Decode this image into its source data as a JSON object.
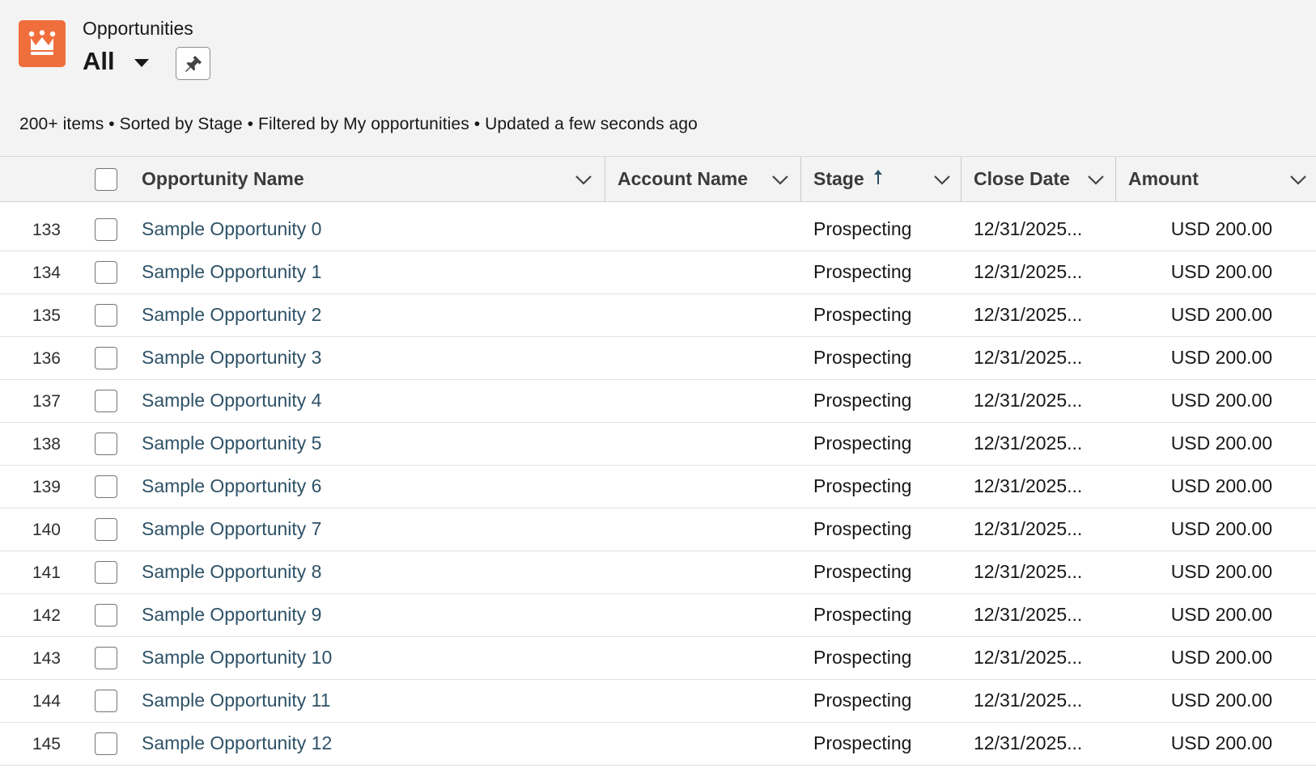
{
  "header": {
    "object_name": "Opportunities",
    "view_name": "All",
    "status_line": "200+ items • Sorted by Stage • Filtered by My opportunities • Updated a few seconds ago",
    "app_icon": "crown-icon",
    "accent_color": "#ef6e3c"
  },
  "table": {
    "columns": [
      {
        "label": "Opportunity Name"
      },
      {
        "label": "Account Name"
      },
      {
        "label": "Stage",
        "sort": "ascending"
      },
      {
        "label": "Close Date"
      },
      {
        "label": "Amount"
      }
    ],
    "rows": [
      {
        "num": "133",
        "name": "Sample Opportunity 0",
        "account": "",
        "stage": "Prospecting",
        "close_date": "12/31/2025...",
        "amount": "USD 200.00"
      },
      {
        "num": "134",
        "name": "Sample Opportunity 1",
        "account": "",
        "stage": "Prospecting",
        "close_date": "12/31/2025...",
        "amount": "USD 200.00"
      },
      {
        "num": "135",
        "name": "Sample Opportunity 2",
        "account": "",
        "stage": "Prospecting",
        "close_date": "12/31/2025...",
        "amount": "USD 200.00"
      },
      {
        "num": "136",
        "name": "Sample Opportunity 3",
        "account": "",
        "stage": "Prospecting",
        "close_date": "12/31/2025...",
        "amount": "USD 200.00"
      },
      {
        "num": "137",
        "name": "Sample Opportunity 4",
        "account": "",
        "stage": "Prospecting",
        "close_date": "12/31/2025...",
        "amount": "USD 200.00"
      },
      {
        "num": "138",
        "name": "Sample Opportunity 5",
        "account": "",
        "stage": "Prospecting",
        "close_date": "12/31/2025...",
        "amount": "USD 200.00"
      },
      {
        "num": "139",
        "name": "Sample Opportunity 6",
        "account": "",
        "stage": "Prospecting",
        "close_date": "12/31/2025...",
        "amount": "USD 200.00"
      },
      {
        "num": "140",
        "name": "Sample Opportunity 7",
        "account": "",
        "stage": "Prospecting",
        "close_date": "12/31/2025...",
        "amount": "USD 200.00"
      },
      {
        "num": "141",
        "name": "Sample Opportunity 8",
        "account": "",
        "stage": "Prospecting",
        "close_date": "12/31/2025...",
        "amount": "USD 200.00"
      },
      {
        "num": "142",
        "name": "Sample Opportunity 9",
        "account": "",
        "stage": "Prospecting",
        "close_date": "12/31/2025...",
        "amount": "USD 200.00"
      },
      {
        "num": "143",
        "name": "Sample Opportunity 10",
        "account": "",
        "stage": "Prospecting",
        "close_date": "12/31/2025...",
        "amount": "USD 200.00"
      },
      {
        "num": "144",
        "name": "Sample Opportunity 11",
        "account": "",
        "stage": "Prospecting",
        "close_date": "12/31/2025...",
        "amount": "USD 200.00"
      },
      {
        "num": "145",
        "name": "Sample Opportunity 12",
        "account": "",
        "stage": "Prospecting",
        "close_date": "12/31/2025...",
        "amount": "USD 200.00"
      }
    ]
  }
}
